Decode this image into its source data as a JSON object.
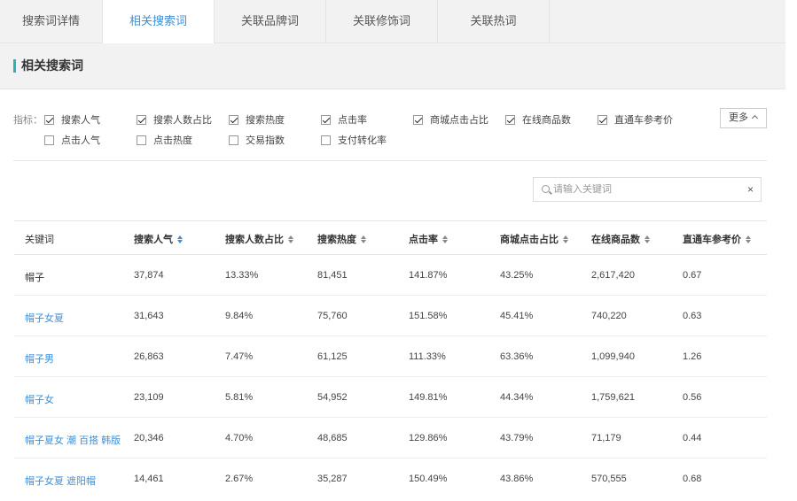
{
  "tabs": [
    {
      "label": "搜索词详情",
      "active": false
    },
    {
      "label": "相关搜索词",
      "active": true
    },
    {
      "label": "关联品牌词",
      "active": false
    },
    {
      "label": "关联修饰词",
      "active": false
    },
    {
      "label": "关联热词",
      "active": false
    }
  ],
  "section": {
    "title": "相关搜索词"
  },
  "filters": {
    "label": "指标：",
    "items": [
      {
        "label": "搜索人气",
        "checked": true
      },
      {
        "label": "搜索人数占比",
        "checked": true
      },
      {
        "label": "搜索热度",
        "checked": true
      },
      {
        "label": "点击率",
        "checked": true
      },
      {
        "label": "商城点击占比",
        "checked": true
      },
      {
        "label": "在线商品数",
        "checked": true
      },
      {
        "label": "直通车参考价",
        "checked": true
      },
      {
        "label": "点击人气",
        "checked": false
      },
      {
        "label": "点击热度",
        "checked": false
      },
      {
        "label": "交易指数",
        "checked": false
      },
      {
        "label": "支付转化率",
        "checked": false
      }
    ],
    "more_label": "更多"
  },
  "search": {
    "placeholder": "请输入关键词",
    "value": "",
    "clear": "×"
  },
  "table": {
    "columns": [
      "关键词",
      "搜索人气",
      "搜索人数占比",
      "搜索热度",
      "点击率",
      "商城点击占比",
      "在线商品数",
      "直通车参考价"
    ],
    "rows": [
      {
        "keyword": "帽子",
        "link": false,
        "cells": [
          "37,874",
          "13.33%",
          "81,451",
          "141.87%",
          "43.25%",
          "2,617,420",
          "0.67"
        ]
      },
      {
        "keyword": "帽子女夏",
        "link": true,
        "cells": [
          "31,643",
          "9.84%",
          "75,760",
          "151.58%",
          "45.41%",
          "740,220",
          "0.63"
        ]
      },
      {
        "keyword": "帽子男",
        "link": true,
        "cells": [
          "26,863",
          "7.47%",
          "61,125",
          "111.33%",
          "63.36%",
          "1,099,940",
          "1.26"
        ]
      },
      {
        "keyword": "帽子女",
        "link": true,
        "cells": [
          "23,109",
          "5.81%",
          "54,952",
          "149.81%",
          "44.34%",
          "1,759,621",
          "0.56"
        ]
      },
      {
        "keyword": "帽子夏女 潮 百搭 韩版",
        "link": true,
        "cells": [
          "20,346",
          "4.70%",
          "48,685",
          "129.86%",
          "43.79%",
          "71,179",
          "0.44"
        ]
      },
      {
        "keyword": "帽子女夏 遮阳帽",
        "link": true,
        "cells": [
          "14,461",
          "2.67%",
          "35,287",
          "150.49%",
          "43.86%",
          "570,555",
          "0.68"
        ]
      }
    ]
  }
}
